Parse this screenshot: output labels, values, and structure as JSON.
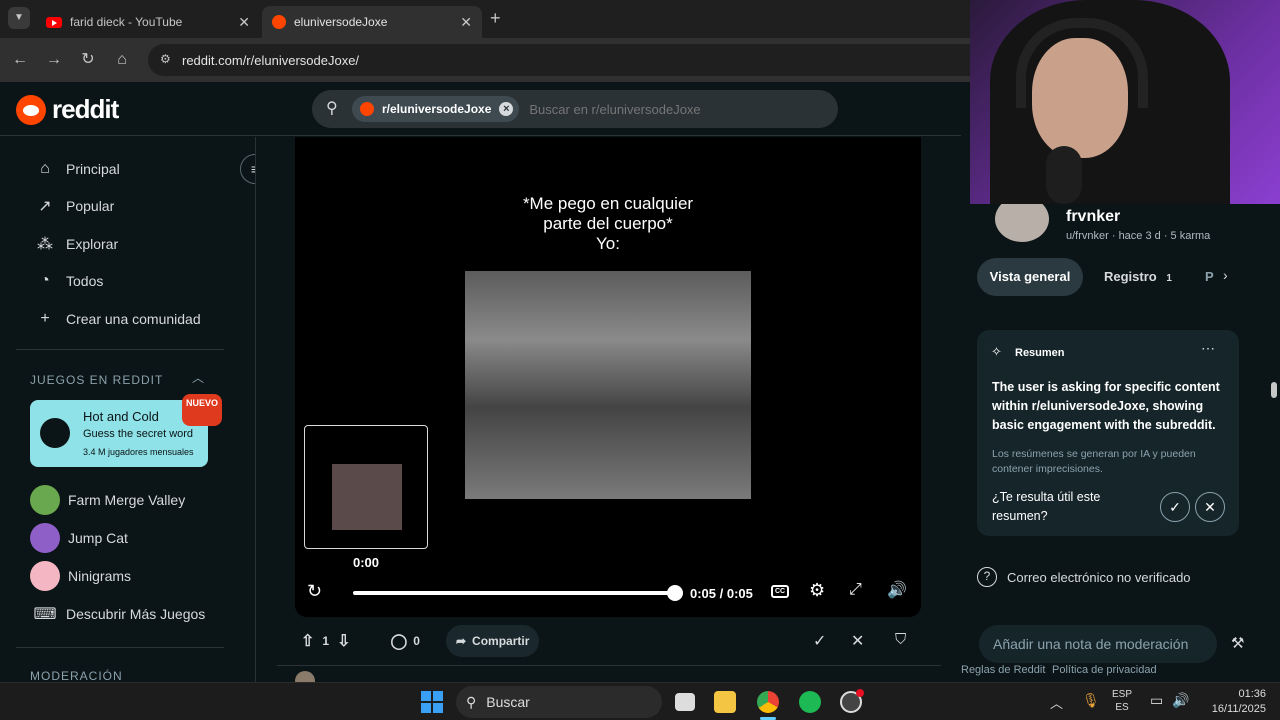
{
  "browser": {
    "tabs": [
      {
        "title": "farid dieck - YouTube",
        "close": "✕"
      },
      {
        "title": "eluniversodeJoxe",
        "close": "✕"
      }
    ],
    "new_tab": "+",
    "url": "reddit.com/r/eluniversodeJoxe/"
  },
  "reddit": {
    "logo_text": "reddit",
    "search": {
      "chip": "r/eluniversodeJoxe",
      "placeholder": "Buscar en r/eluniversodeJoxe"
    }
  },
  "sidebar": {
    "nav": [
      {
        "label": "Principal",
        "icon": "home-icon"
      },
      {
        "label": "Popular",
        "icon": "popular-icon"
      },
      {
        "label": "Explorar",
        "icon": "explore-icon"
      },
      {
        "label": "Todos",
        "icon": "all-icon"
      },
      {
        "label": "Crear una comunidad",
        "icon": "plus-icon"
      }
    ],
    "games_title": "JUEGOS EN REDDIT",
    "featured_game": {
      "title": "Hot and Cold",
      "subtitle": "Guess the secret word",
      "players": "3.4 M jugadores mensuales",
      "badge": "NUEVO"
    },
    "games": [
      {
        "label": "Farm Merge Valley",
        "color": "#6aa84f"
      },
      {
        "label": "Jump Cat",
        "color": "#8e5fc7"
      },
      {
        "label": "Ninigrams",
        "color": "#f4b6c2"
      },
      {
        "label": "Descubrir Más Juegos",
        "color": ""
      }
    ],
    "moderation_title": "MODERACIÓN"
  },
  "post": {
    "caption": "*Me pego en cualquier\nparte del cuerpo*\nYo:",
    "preview_time": "0:00",
    "time": "0:05 / 0:05",
    "progress": 1.0,
    "votes": "1",
    "comments": "0",
    "share": "Compartir"
  },
  "user_panel": {
    "name": "frvnker",
    "meta": "u/frvnker · hace 3 d · 5 karma",
    "tabs": [
      {
        "label": "Vista general"
      },
      {
        "label": "Registro",
        "count": "1"
      },
      {
        "label": "P"
      }
    ],
    "summary": {
      "title": "Resumen",
      "body": "The user is asking for specific content within r/eluniversodeJoxe, showing basic engagement with the subreddit.",
      "disclaimer": "Los resúmenes se generan por IA y pueden contener imprecisiones.",
      "question": "¿Te resulta útil este resumen?"
    },
    "email_status": "Correo electrónico no verificado",
    "mod_note_placeholder": "Añadir una nota de moderación",
    "footer_links": [
      "Reglas de Reddit",
      "Política de privacidad"
    ]
  },
  "taskbar": {
    "search_label": "Buscar",
    "lang_top": "ESP",
    "lang_bottom": "ES",
    "time": "01:36",
    "date": "16/11/2025"
  }
}
